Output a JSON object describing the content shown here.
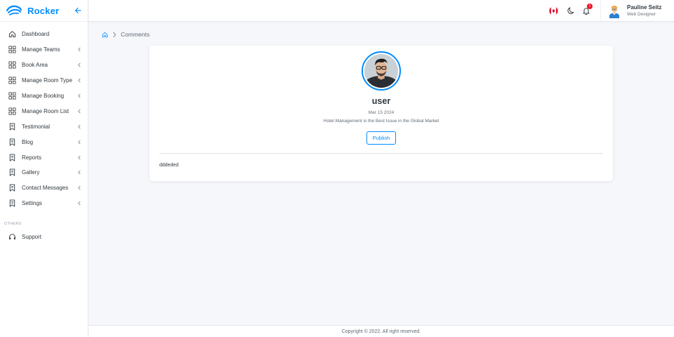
{
  "brand": {
    "name": "Rocker"
  },
  "sidebar": {
    "items": [
      {
        "label": "Dashboard",
        "icon": "home-icon",
        "has_arrow": false
      },
      {
        "label": "Manage Teams",
        "icon": "grid-icon",
        "has_arrow": true
      },
      {
        "label": "Book Area",
        "icon": "grid-icon",
        "has_arrow": true
      },
      {
        "label": "Manage Room Type",
        "icon": "grid-icon",
        "has_arrow": true
      },
      {
        "label": "Manage Booking",
        "icon": "grid-icon",
        "has_arrow": true
      },
      {
        "label": "Manage Room List",
        "icon": "grid-icon",
        "has_arrow": true
      },
      {
        "label": "Testimonial",
        "icon": "bookmark-icon",
        "has_arrow": true
      },
      {
        "label": "Blog",
        "icon": "bookmark-icon",
        "has_arrow": true
      },
      {
        "label": "Reports",
        "icon": "bookmark-icon",
        "has_arrow": true
      },
      {
        "label": "Gallery",
        "icon": "bookmark-icon",
        "has_arrow": true
      },
      {
        "label": "Contact Messages",
        "icon": "bookmark-icon",
        "has_arrow": true
      },
      {
        "label": "Settings",
        "icon": "bookmark-icon",
        "has_arrow": true
      }
    ],
    "section_others": "OTHERS",
    "others": [
      {
        "label": "Support",
        "icon": "headset-icon"
      }
    ]
  },
  "topbar": {
    "notification_count": "1",
    "user_name": "Pauline Seitz",
    "user_role": "Web Designer"
  },
  "breadcrumb": {
    "current": "Comments"
  },
  "comment": {
    "name": "user",
    "date": "Mar 15 2024",
    "subject": "Hotel Management is the Best Issue in the Global Market",
    "publish_label": "Publish",
    "message": "dddeded"
  },
  "footer": {
    "copyright": "Copyright © 2022. All right reserved."
  },
  "colors": {
    "accent": "#008cff",
    "badge": "#f41127",
    "background": "#f6f7fb"
  }
}
